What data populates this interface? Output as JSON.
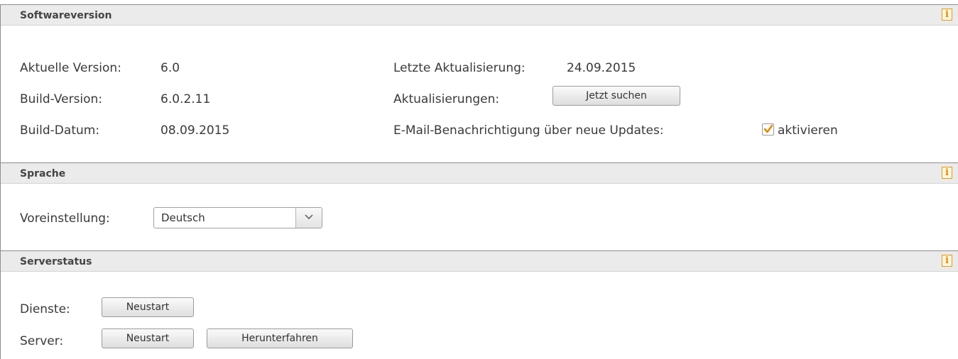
{
  "software": {
    "title": "Softwareversion",
    "current_version_label": "Aktuelle Version:",
    "current_version": "6.0",
    "build_version_label": "Build-Version:",
    "build_version": "6.0.2.11",
    "build_date_label": "Build-Datum:",
    "build_date": "08.09.2015",
    "last_update_label": "Letzte Aktualisierung:",
    "last_update": "24.09.2015",
    "updates_label": "Aktualisierungen:",
    "search_button": "Jetzt suchen",
    "email_notify_label": "E-Mail-Benachrichtigung über neue Updates:",
    "email_notify_checked": true,
    "email_notify_checkbox_label": "aktivieren"
  },
  "language": {
    "title": "Sprache",
    "default_label": "Voreinstellung:",
    "default_value": "Deutsch"
  },
  "server": {
    "title": "Serverstatus",
    "services_label": "Dienste:",
    "services_restart_button": "Neustart",
    "server_label": "Server:",
    "server_restart_button": "Neustart",
    "shutdown_button": "Herunterfahren"
  },
  "icons": {
    "info": "info-icon",
    "checkmark": "checkmark-icon",
    "dropdown": "chevron-down-icon"
  },
  "colors": {
    "accent": "#e28a00",
    "header_bg": "#ebebeb"
  }
}
